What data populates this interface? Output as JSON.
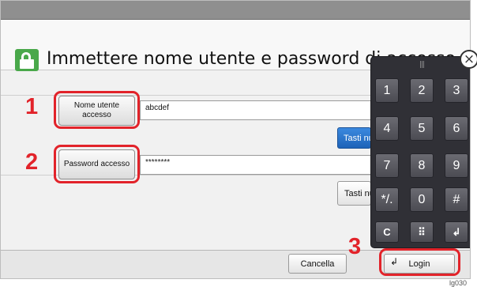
{
  "header": {
    "title": "Immettere nome utente e password di accesso."
  },
  "form": {
    "username": {
      "label": "Nome utente accesso",
      "value": "abcdef",
      "keyboard_button": "Tasti numerici"
    },
    "password": {
      "label": "Password accesso",
      "value": "********",
      "keyboard_button": "Tasti numerici"
    }
  },
  "steps": [
    "1",
    "2",
    "3"
  ],
  "footer": {
    "cancel_label": "Cancella",
    "login_label": "Login"
  },
  "keypad": {
    "keys": [
      "1",
      "2",
      "3",
      "4",
      "5",
      "6",
      "7",
      "8",
      "9",
      "*/.",
      "0",
      "#"
    ],
    "bottom_keys": [
      "C",
      "⠿",
      "↲"
    ]
  },
  "caption": "lg030",
  "colors": {
    "highlight": "#e2232a",
    "blue_button": "#2572cc",
    "keypad": "#303036"
  }
}
